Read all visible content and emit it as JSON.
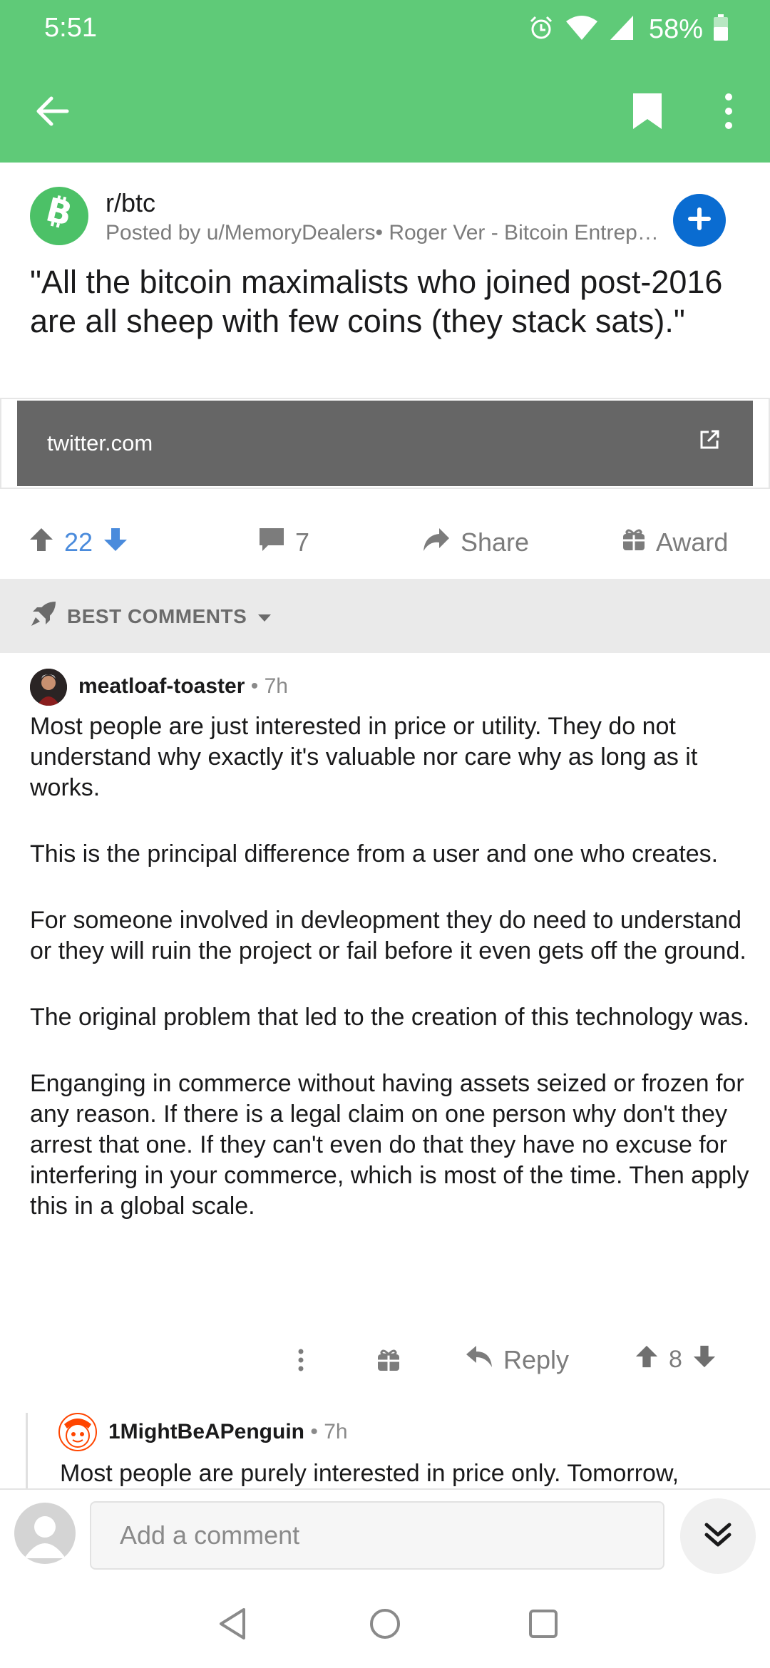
{
  "status": {
    "time": "5:51",
    "battery": "58%"
  },
  "app_bar": {
    "back_icon": "arrow-left-icon",
    "bookmark_icon": "bookmark-icon",
    "more_icon": "vertical-dots-icon"
  },
  "post": {
    "subreddit": "r/btc",
    "posted_by": "Posted by u/MemoryDealers• Roger Ver - Bitcoin Entrepreneur",
    "title": "\"All the bitcoin maximalists who joined post-2016 are all sheep with few coins (they stack sats).\"",
    "link_domain": "twitter.com",
    "score": "22",
    "comment_count": "7",
    "share_label": "Share",
    "award_label": "Award"
  },
  "sort": {
    "label": "BEST COMMENTS"
  },
  "comment": {
    "author": "meatloaf-toaster",
    "time": "7h",
    "paragraphs": [
      "Most people are just interested in price or utility. They do not understand why exactly it's valuable nor care why as long as it works.",
      "This is the principal difference from a user and one who creates.",
      "For someone involved in devleopment they do need to understand or they will ruin the project or fail before it even gets off the ground.",
      "The original problem that led to the creation of this technology was.",
      "Enganging in commerce without having assets seized or frozen for any reason. If there is a legal claim on one person why don't they arrest that one. If they can't even do that they have no excuse for interfering in your commerce, which is most of the time. Then apply this in a global scale."
    ],
    "reply_label": "Reply",
    "score": "8"
  },
  "reply": {
    "author": "1MightBeAPenguin",
    "time": "7h",
    "body": "Most people are purely interested in price only. Tomorrow,"
  },
  "composer": {
    "placeholder": "Add a comment"
  },
  "colors": {
    "brand": "#5fca78",
    "join": "#0a6cd1",
    "score": "#4a8bdc"
  }
}
